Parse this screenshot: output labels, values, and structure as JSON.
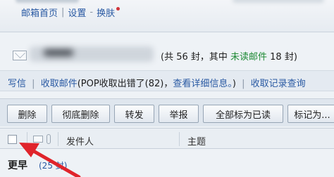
{
  "header": {
    "links": [
      "邮箱首页",
      "设置",
      "换肤"
    ]
  },
  "mailbox": {
    "count_prefix": "(共 56 封，其中 ",
    "unread_label": "未读邮件",
    "count_suffix": " 18 封)"
  },
  "actions": {
    "write": "写信",
    "receive": "收取邮件",
    "pop_error": "(POP收取出错了(82)，",
    "view_details": "查看详细信息。",
    "close_paren": ")",
    "receive_log": "收取记录查询"
  },
  "toolbar": {
    "buttons": [
      "删除",
      "彻底删除",
      "转发",
      "举报",
      "全部标为已读",
      "标记为..."
    ]
  },
  "list_header": {
    "sender": "发件人",
    "subject": "主题"
  },
  "group": {
    "label": "更早",
    "count": "(25 封)"
  },
  "colors": {
    "link": "#2a5aa3",
    "unread": "#1f8a35",
    "annotation_arrow": "#e0242b"
  },
  "icons": [
    "envelope-icon",
    "attachment-icon",
    "caret-down-icon",
    "red-arrow-annotation"
  ]
}
